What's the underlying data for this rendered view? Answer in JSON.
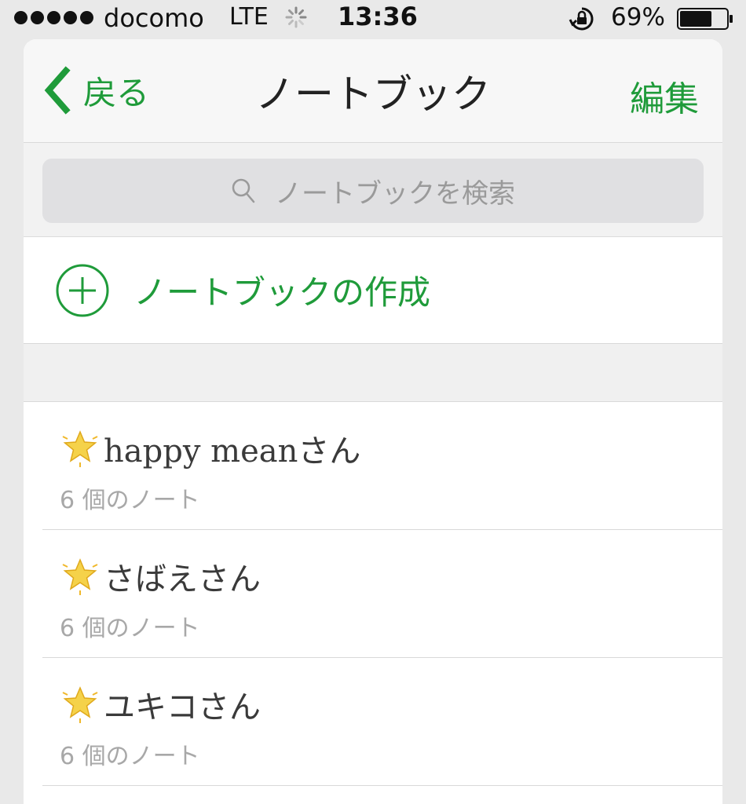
{
  "status_bar": {
    "carrier": "docomo",
    "network": "LTE",
    "time": "13:36",
    "battery_percent": "69%",
    "battery_level": 0.69
  },
  "nav": {
    "back_label": "戻る",
    "title": "ノートブック",
    "edit_label": "編集"
  },
  "search": {
    "placeholder": "ノートブックを検索"
  },
  "create": {
    "label": "ノートブックの作成"
  },
  "notebooks": [
    {
      "title": "happy meanさん",
      "count": "6 個のノート",
      "icon": "glowing-star-icon"
    },
    {
      "title": "さばえさん",
      "count": "6 個のノート",
      "icon": "glowing-star-icon"
    },
    {
      "title": "ユキコさん",
      "count": "6 個のノート",
      "icon": "glowing-star-icon"
    }
  ],
  "colors": {
    "accent": "#1f9b3a",
    "background": "#e9e9e9"
  }
}
